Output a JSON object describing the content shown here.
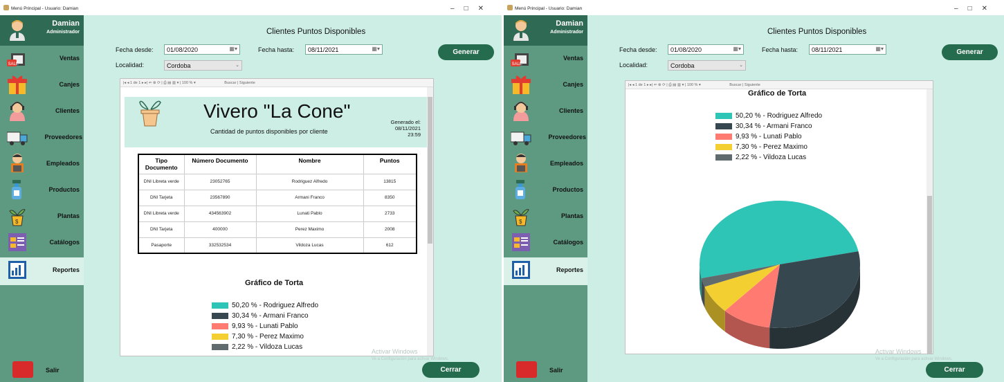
{
  "window_title": "Menú Principal - Usuario: Damian",
  "window_controls": [
    "–",
    "□",
    "✕"
  ],
  "user": {
    "name": "Damian",
    "role": "Administrador"
  },
  "menu": [
    {
      "label": "Ventas",
      "icon": "sale-bag-icon"
    },
    {
      "label": "Canjes",
      "icon": "gift-icon"
    },
    {
      "label": "Clientes",
      "icon": "client-icon"
    },
    {
      "label": "Proveedores",
      "icon": "truck-icon"
    },
    {
      "label": "Empleados",
      "icon": "employee-icon"
    },
    {
      "label": "Productos",
      "icon": "spray-bottle-icon"
    },
    {
      "label": "Plantas",
      "icon": "plant-pot-icon"
    },
    {
      "label": "Catálogos",
      "icon": "catalog-icon"
    },
    {
      "label": "Reportes",
      "icon": "report-icon"
    }
  ],
  "salir_label": "Salir",
  "page_title": "Clientes Puntos Disponibles",
  "filters": {
    "fecha_desde_label": "Fecha desde:",
    "fecha_desde": "01/08/2020",
    "fecha_hasta_label": "Fecha hasta:",
    "fecha_hasta": "08/11/2021",
    "localidad_label": "Localidad:",
    "localidad": "Cordoba"
  },
  "generar_label": "Generar",
  "cerrar_label": "Cerrar",
  "viewer_toolbar": {
    "page_of": "1   de 1",
    "zoom": "100 %",
    "buscar": "Buscar",
    "siguiente": "Siguiente"
  },
  "report": {
    "brand": "Vivero \"La Cone\"",
    "subtitle": "Cantidad de puntos disponibles por cliente",
    "generated_label": "Generado el:",
    "generated_date": "08/11/2021",
    "generated_time": "23:59",
    "columns": [
      "Tipo Documento",
      "Número Documento",
      "Nombre",
      "Puntos"
    ],
    "rows": [
      [
        "DNI Libreta verde",
        "23052765",
        "Rodriguez Alfredo",
        "13815"
      ],
      [
        "DNI Tarjeta",
        "23567890",
        "Armani Franco",
        "8350"
      ],
      [
        "DNI Libreta verde",
        "434563902",
        "Lunati Pablo",
        "2733"
      ],
      [
        "DNI Tarjeta",
        "400000",
        "Perez Maximo",
        "2008"
      ],
      [
        "Pasaporte",
        "332532534",
        "Vildoza Lucas",
        "612"
      ]
    ],
    "pie_title": "Gráfico de Torta",
    "legend": [
      "50,20 % - Rodriguez Alfredo",
      "30,34 % - Armani Franco",
      "9,93 % - Lunati Pablo",
      "7,30 % - Perez Maximo",
      "2,22 % - Vildoza Lucas"
    ]
  },
  "chart_data": {
    "type": "pie",
    "title": "Gráfico de Torta",
    "categories": [
      "Rodriguez Alfredo",
      "Armani Franco",
      "Lunati Pablo",
      "Perez Maximo",
      "Vildoza Lucas"
    ],
    "values": [
      50.2,
      30.34,
      9.93,
      7.3,
      2.22
    ],
    "colors": [
      "#2ec4b6",
      "#37474f",
      "#ff7b72",
      "#f4cf32",
      "#5f6b6d"
    ],
    "legend_position": "top-left"
  },
  "watermark": {
    "line1": "Activar Windows",
    "line2": "Ve a Configuración para activar Windows."
  },
  "colors": {
    "sidebar": "#5e9a82",
    "sidebar_header": "#2f6b54",
    "background": "#cdeee4",
    "button": "#256b4e"
  }
}
